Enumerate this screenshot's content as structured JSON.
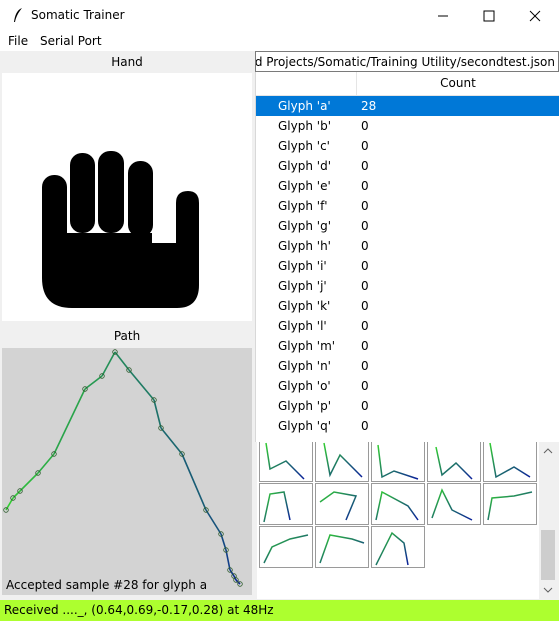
{
  "window": {
    "title": "Somatic Trainer",
    "icons": {
      "app": "feather-icon",
      "minimize": "minimize-icon",
      "maximize": "maximize-icon",
      "close": "close-icon"
    }
  },
  "menu": {
    "items": [
      "File",
      "Serial Port"
    ]
  },
  "left": {
    "hand_header": "Hand",
    "hand_icon": "fist-hand-icon",
    "path_header": "Path",
    "path_status": "Accepted sample #28 for glyph a"
  },
  "right": {
    "file_path": "trolled Projects/Somatic/Training Utility/secondtest.json",
    "columns": [
      "",
      "Count"
    ],
    "rows": [
      {
        "label": "Glyph 'a'",
        "count": "28",
        "selected": true
      },
      {
        "label": "Glyph 'b'",
        "count": "0"
      },
      {
        "label": "Glyph 'c'",
        "count": "0"
      },
      {
        "label": "Glyph 'd'",
        "count": "0"
      },
      {
        "label": "Glyph 'e'",
        "count": "0"
      },
      {
        "label": "Glyph 'f'",
        "count": "0"
      },
      {
        "label": "Glyph 'g'",
        "count": "0"
      },
      {
        "label": "Glyph 'h'",
        "count": "0"
      },
      {
        "label": "Glyph 'i'",
        "count": "0"
      },
      {
        "label": "Glyph 'j'",
        "count": "0"
      },
      {
        "label": "Glyph 'k'",
        "count": "0"
      },
      {
        "label": "Glyph 'l'",
        "count": "0"
      },
      {
        "label": "Glyph 'm'",
        "count": "0"
      },
      {
        "label": "Glyph 'n'",
        "count": "0"
      },
      {
        "label": "Glyph 'o'",
        "count": "0"
      },
      {
        "label": "Glyph 'p'",
        "count": "0"
      },
      {
        "label": "Glyph 'q'",
        "count": "0"
      }
    ],
    "thumbnail_count": 13
  },
  "status_bar": {
    "text": "Received ...._, (0.64,0.69,-0.17,0.28) at 48Hz",
    "color": "#adff2f"
  },
  "colors": {
    "selection": "#0078d7",
    "path_bg": "#d3d3d3",
    "stroke_start": "#32cd32",
    "stroke_end": "#0a1f9a"
  }
}
